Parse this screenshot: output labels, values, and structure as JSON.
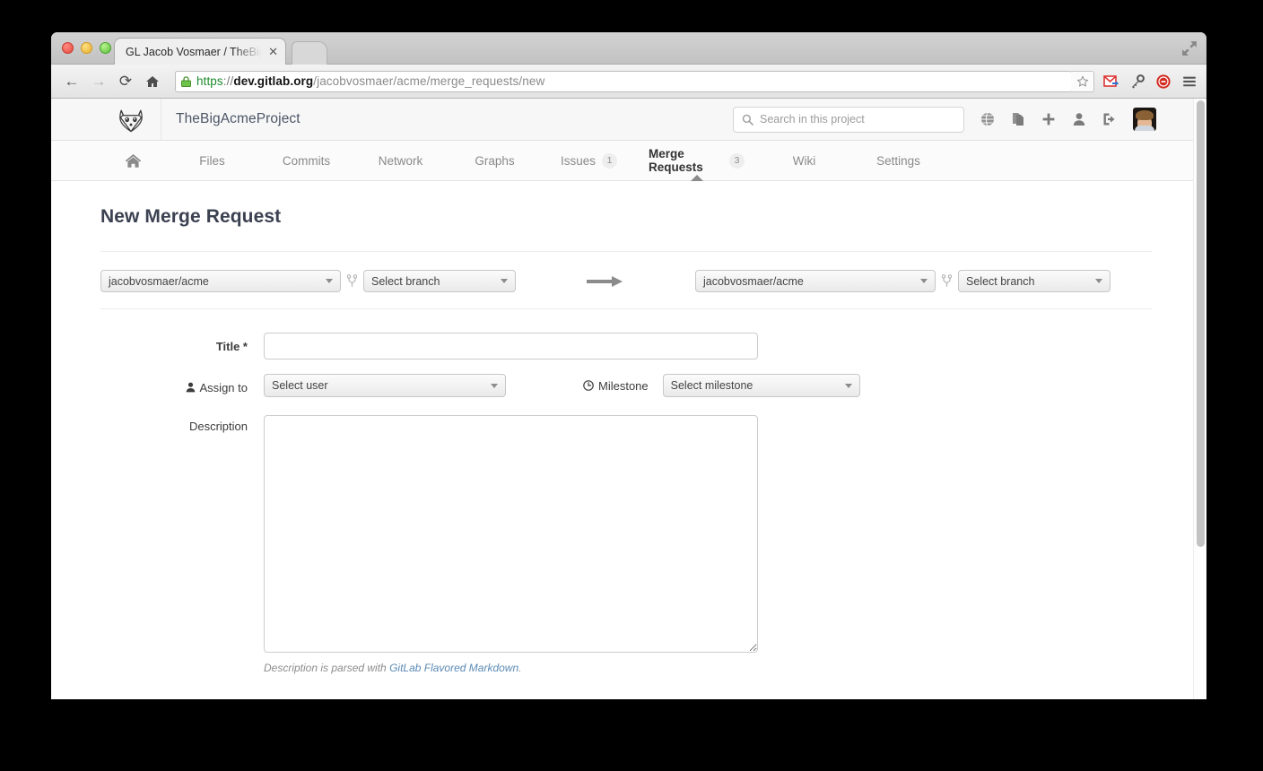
{
  "browser": {
    "tab_title": "GL Jacob Vosmaer / TheBigAc",
    "tab_close_glyph": "✕",
    "back_glyph": "←",
    "forward_glyph": "→",
    "reload_glyph": "⟳",
    "url": {
      "scheme": "https",
      "sep": "://",
      "host": "dev.gitlab.org",
      "path": "/jacobvosmaer/acme/merge_requests/new",
      "full": "https://dev.gitlab.org/jacobvosmaer/acme/merge_requests/new"
    },
    "extensions": [
      "bookmark-star-icon",
      "gmail-icon",
      "lastpass-key-icon",
      "adblock-icon",
      "chrome-menu-icon"
    ]
  },
  "gitlab_header": {
    "logo": "gitlab-tanuki-icon",
    "project_name": "TheBigAcmeProject",
    "search": {
      "placeholder": "Search in this project",
      "value": "",
      "icon": "search-icon"
    },
    "icons": [
      "globe-icon",
      "snippets-icon",
      "plus-icon",
      "user-icon",
      "sign-out-icon"
    ],
    "avatar": "user-avatar"
  },
  "nav": {
    "items": [
      {
        "label": "",
        "icon": "home-icon",
        "badge": "",
        "active": false
      },
      {
        "label": "Files",
        "icon": "",
        "badge": "",
        "active": false
      },
      {
        "label": "Commits",
        "icon": "",
        "badge": "",
        "active": false
      },
      {
        "label": "Network",
        "icon": "",
        "badge": "",
        "active": false
      },
      {
        "label": "Graphs",
        "icon": "",
        "badge": "",
        "active": false
      },
      {
        "label": "Issues",
        "icon": "",
        "badge": "1",
        "active": false
      },
      {
        "label": "Merge Requests",
        "icon": "",
        "badge": "3",
        "active": true
      },
      {
        "label": "Wiki",
        "icon": "",
        "badge": "",
        "active": false
      },
      {
        "label": "Settings",
        "icon": "",
        "badge": "",
        "active": false
      }
    ]
  },
  "main": {
    "page_title": "New Merge Request",
    "source": {
      "project": "jacobvosmaer/acme",
      "branch_placeholder": "Select branch",
      "fork_icon": "branch-fork-icon"
    },
    "arrow": "arrow-right-icon",
    "target": {
      "project": "jacobvosmaer/acme",
      "branch_placeholder": "Select branch",
      "fork_icon": "branch-fork-icon"
    },
    "form": {
      "title_label": "Title *",
      "title_value": "",
      "assign_label": "Assign to",
      "assign_icon": "user-icon",
      "assign_value": "Select user",
      "milestone_label": "Milestone",
      "milestone_icon": "clock-icon",
      "milestone_value": "Select milestone",
      "description_label": "Description",
      "description_value": "",
      "help_prefix": "Description is parsed with ",
      "help_link": "GitLab Flavored Markdown",
      "help_suffix": "."
    }
  },
  "colors": {
    "accent": "#5c8ab5",
    "page_title": "#3b4151",
    "link": "#5c8ab5",
    "nav_inactive": "#8a8a8a",
    "nav_active": "#333333"
  }
}
